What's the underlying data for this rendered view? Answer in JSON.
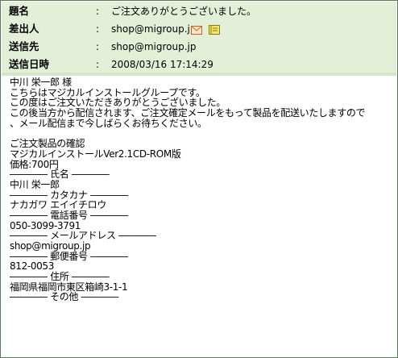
{
  "header": {
    "subject": {
      "label": "題名",
      "value": "ご注文ありがとうございました。"
    },
    "sender": {
      "label": "差出人",
      "value": "shop@migroup.jp",
      "icons": [
        "envelope-icon",
        "address-book-icon"
      ]
    },
    "recipient": {
      "label": "送信先",
      "value": "shop@migroup.jp"
    },
    "sent_at": {
      "label": "送信日時",
      "value": "2008/03/16 17:14:29"
    },
    "colon": ":"
  },
  "body": {
    "lines": [
      "中川 栄一郎 様",
      "こちらはマジカルインストールグループです。",
      "この度はご注文いただきありがとうございました。",
      "この後当方から配信されます、ご注文確定メールをもって製品を配送いたしますので",
      "、メール配信まで今しばらくお待ちください。",
      "",
      "ご注文製品の確認",
      "マジカルインストールVer2.1CD-ROM版",
      "価格:700円",
      "―――― 氏名 ――――",
      "中川 栄一郎",
      "―――― カタカナ ――――",
      "ナカガワ エイイチロウ",
      "―――― 電話番号 ――――",
      "050-3099-3791",
      "―――― メールアドレス ――――",
      "shop@migroup.jp",
      "―――― 郵便番号 ――――",
      "812-0053",
      "―――― 住所 ――――",
      "福岡県福岡市東区箱崎3-1-1",
      "―――― その他 ――――"
    ]
  },
  "colors": {
    "header_bg": "#e4efd8",
    "separator": "#d4e6c6",
    "border": "#5e7a5e"
  }
}
